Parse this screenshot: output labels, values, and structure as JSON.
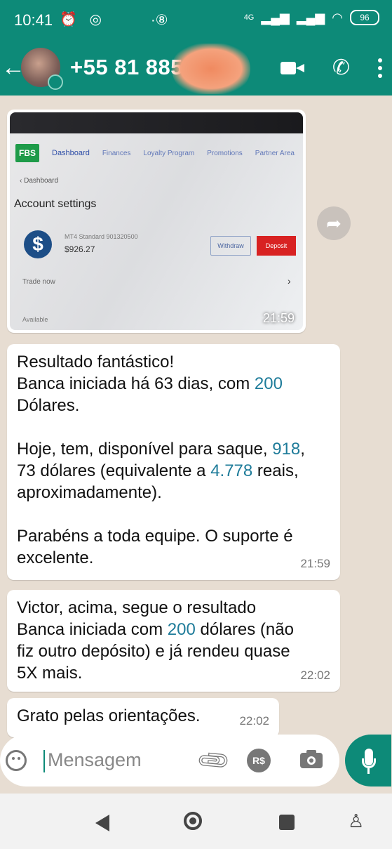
{
  "status_bar": {
    "time": "10:41",
    "left_icons": "⏰ ◎",
    "center_icon": "·⑧",
    "network": "4G",
    "battery": "96"
  },
  "header": {
    "contact_visible": "+55 81 885",
    "back_icon": "back-arrow-icon",
    "video_icon": "video-call-icon",
    "phone_icon": "phone-icon",
    "menu_icon": "more-vert-icon"
  },
  "image_message": {
    "screenshot": {
      "nav_items": [
        "Dashboard",
        "Finances",
        "Loyalty Program",
        "Promotions",
        "Partner Area"
      ],
      "logo": "FBS",
      "breadcrumb": "Dashboard",
      "page_title": "Account settings",
      "account_line": "MT4 Standard 901320500",
      "balance": "$926.27",
      "withdraw": "Withdraw",
      "deposit": "Deposit",
      "trade_now": "Trade now",
      "available": "Available"
    },
    "time": "21:59"
  },
  "messages": [
    {
      "time": "21:59",
      "lines": {
        "l1": "Resultado fantástico!",
        "l2_pre": "Banca iniciada há 63 dias, com ",
        "l2_num": "200",
        "l3": "Dólares.",
        "l4_pre": "Hoje, tem, disponível para saque, ",
        "l4_num": "918",
        "l4_post": ",",
        "l5_pre": "73 dólares (equivalente a ",
        "l5_num": "4.778",
        "l5_post": " reais,",
        "l6": "aproximadamente).",
        "l7": "Parabéns a toda equipe. O suporte é",
        "l8": "excelente."
      }
    },
    {
      "time": "22:02",
      "lines": {
        "l1": "Victor, acima, segue o resultado",
        "l2_pre": "Banca iniciada com ",
        "l2_num": "200",
        "l2_post": " dólares (não",
        "l3": "fiz outro depósito) e já rendeu quase",
        "l4": "5X mais."
      }
    },
    {
      "time": "22:02",
      "text": "Grato pelas orientações."
    }
  ],
  "input": {
    "placeholder": "Mensagem",
    "currency_label": "R$"
  }
}
